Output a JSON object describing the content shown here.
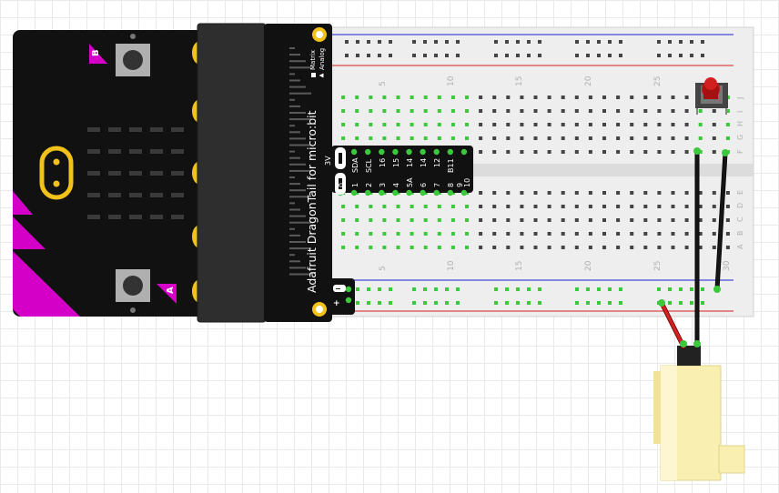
{
  "breadboard": {
    "top_column_numbers": [
      "5",
      "10",
      "15",
      "20",
      "25"
    ],
    "bottom_column_numbers": [
      "5",
      "10",
      "15",
      "20",
      "25",
      "30"
    ],
    "rows_upper": [
      "J",
      "I",
      "H",
      "G",
      "F"
    ],
    "rows_lower": [
      "E",
      "D",
      "C",
      "B",
      "A"
    ]
  },
  "dragontail": {
    "title": "Adafruit DragonTail for micro:bit",
    "legend_matrix": "Matrix",
    "legend_analog": "Analog",
    "pin_labels_row1": [
      "3V",
      "SDA",
      "SCL",
      "16",
      "15",
      "14",
      "14",
      "12",
      "B11"
    ],
    "pin_labels_row2": [
      "0",
      "1",
      "2",
      "3",
      "4",
      "5A",
      "6",
      "7",
      "8",
      "9",
      "10"
    ],
    "minus_sign": "−",
    "plus_sign": "+"
  },
  "microbit": {
    "button_a": "A",
    "button_b": "B"
  },
  "colors": {
    "board_black": "#111111",
    "microbit_magenta": "#d400c8",
    "gold_pad": "#f2c11a",
    "breadboard": "#eeeeee",
    "hole_green": "#3cc83c",
    "rail_red": "#d42020",
    "rail_blue": "#2020d4",
    "wire_red": "#d42020",
    "wire_black": "#151515",
    "servo": "#f8efb0",
    "button_red": "#b81616"
  }
}
